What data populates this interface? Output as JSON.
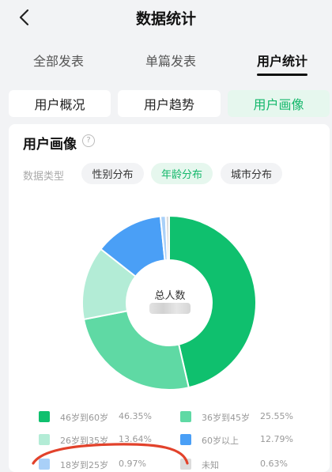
{
  "header": {
    "title": "数据统计"
  },
  "tabs": [
    {
      "label": "全部发表"
    },
    {
      "label": "单篇发表"
    },
    {
      "label": "用户统计"
    }
  ],
  "segments": [
    {
      "label": "用户概况"
    },
    {
      "label": "用户趋势"
    },
    {
      "label": "用户画像"
    }
  ],
  "portrait": {
    "title": "用户画像",
    "help_glyph": "?",
    "type_label": "数据类型",
    "filters": [
      {
        "label": "性别分布"
      },
      {
        "label": "年龄分布"
      },
      {
        "label": "城市分布"
      }
    ],
    "center_label": "总人数"
  },
  "chart_data": {
    "type": "pie",
    "slices": [
      {
        "label": "46岁到60岁",
        "value": 46.35,
        "pct": "46.35%",
        "color": "#0fc06e"
      },
      {
        "label": "36岁到45岁",
        "value": 25.55,
        "pct": "25.55%",
        "color": "#5fd9a4"
      },
      {
        "label": "26岁到35岁",
        "value": 13.64,
        "pct": "13.64%",
        "color": "#b3ecd6"
      },
      {
        "label": "60岁以上",
        "value": 12.79,
        "pct": "12.79%",
        "color": "#4a9ff6"
      },
      {
        "label": "18岁到25岁",
        "value": 0.97,
        "pct": "0.97%",
        "color": "#a9d0f8"
      },
      {
        "label": "未知",
        "value": 0.63,
        "pct": "0.63%",
        "color": "#dcdcdc"
      }
    ]
  },
  "colors": {
    "accent": "#12b76a",
    "annotation": "#e2422b"
  }
}
